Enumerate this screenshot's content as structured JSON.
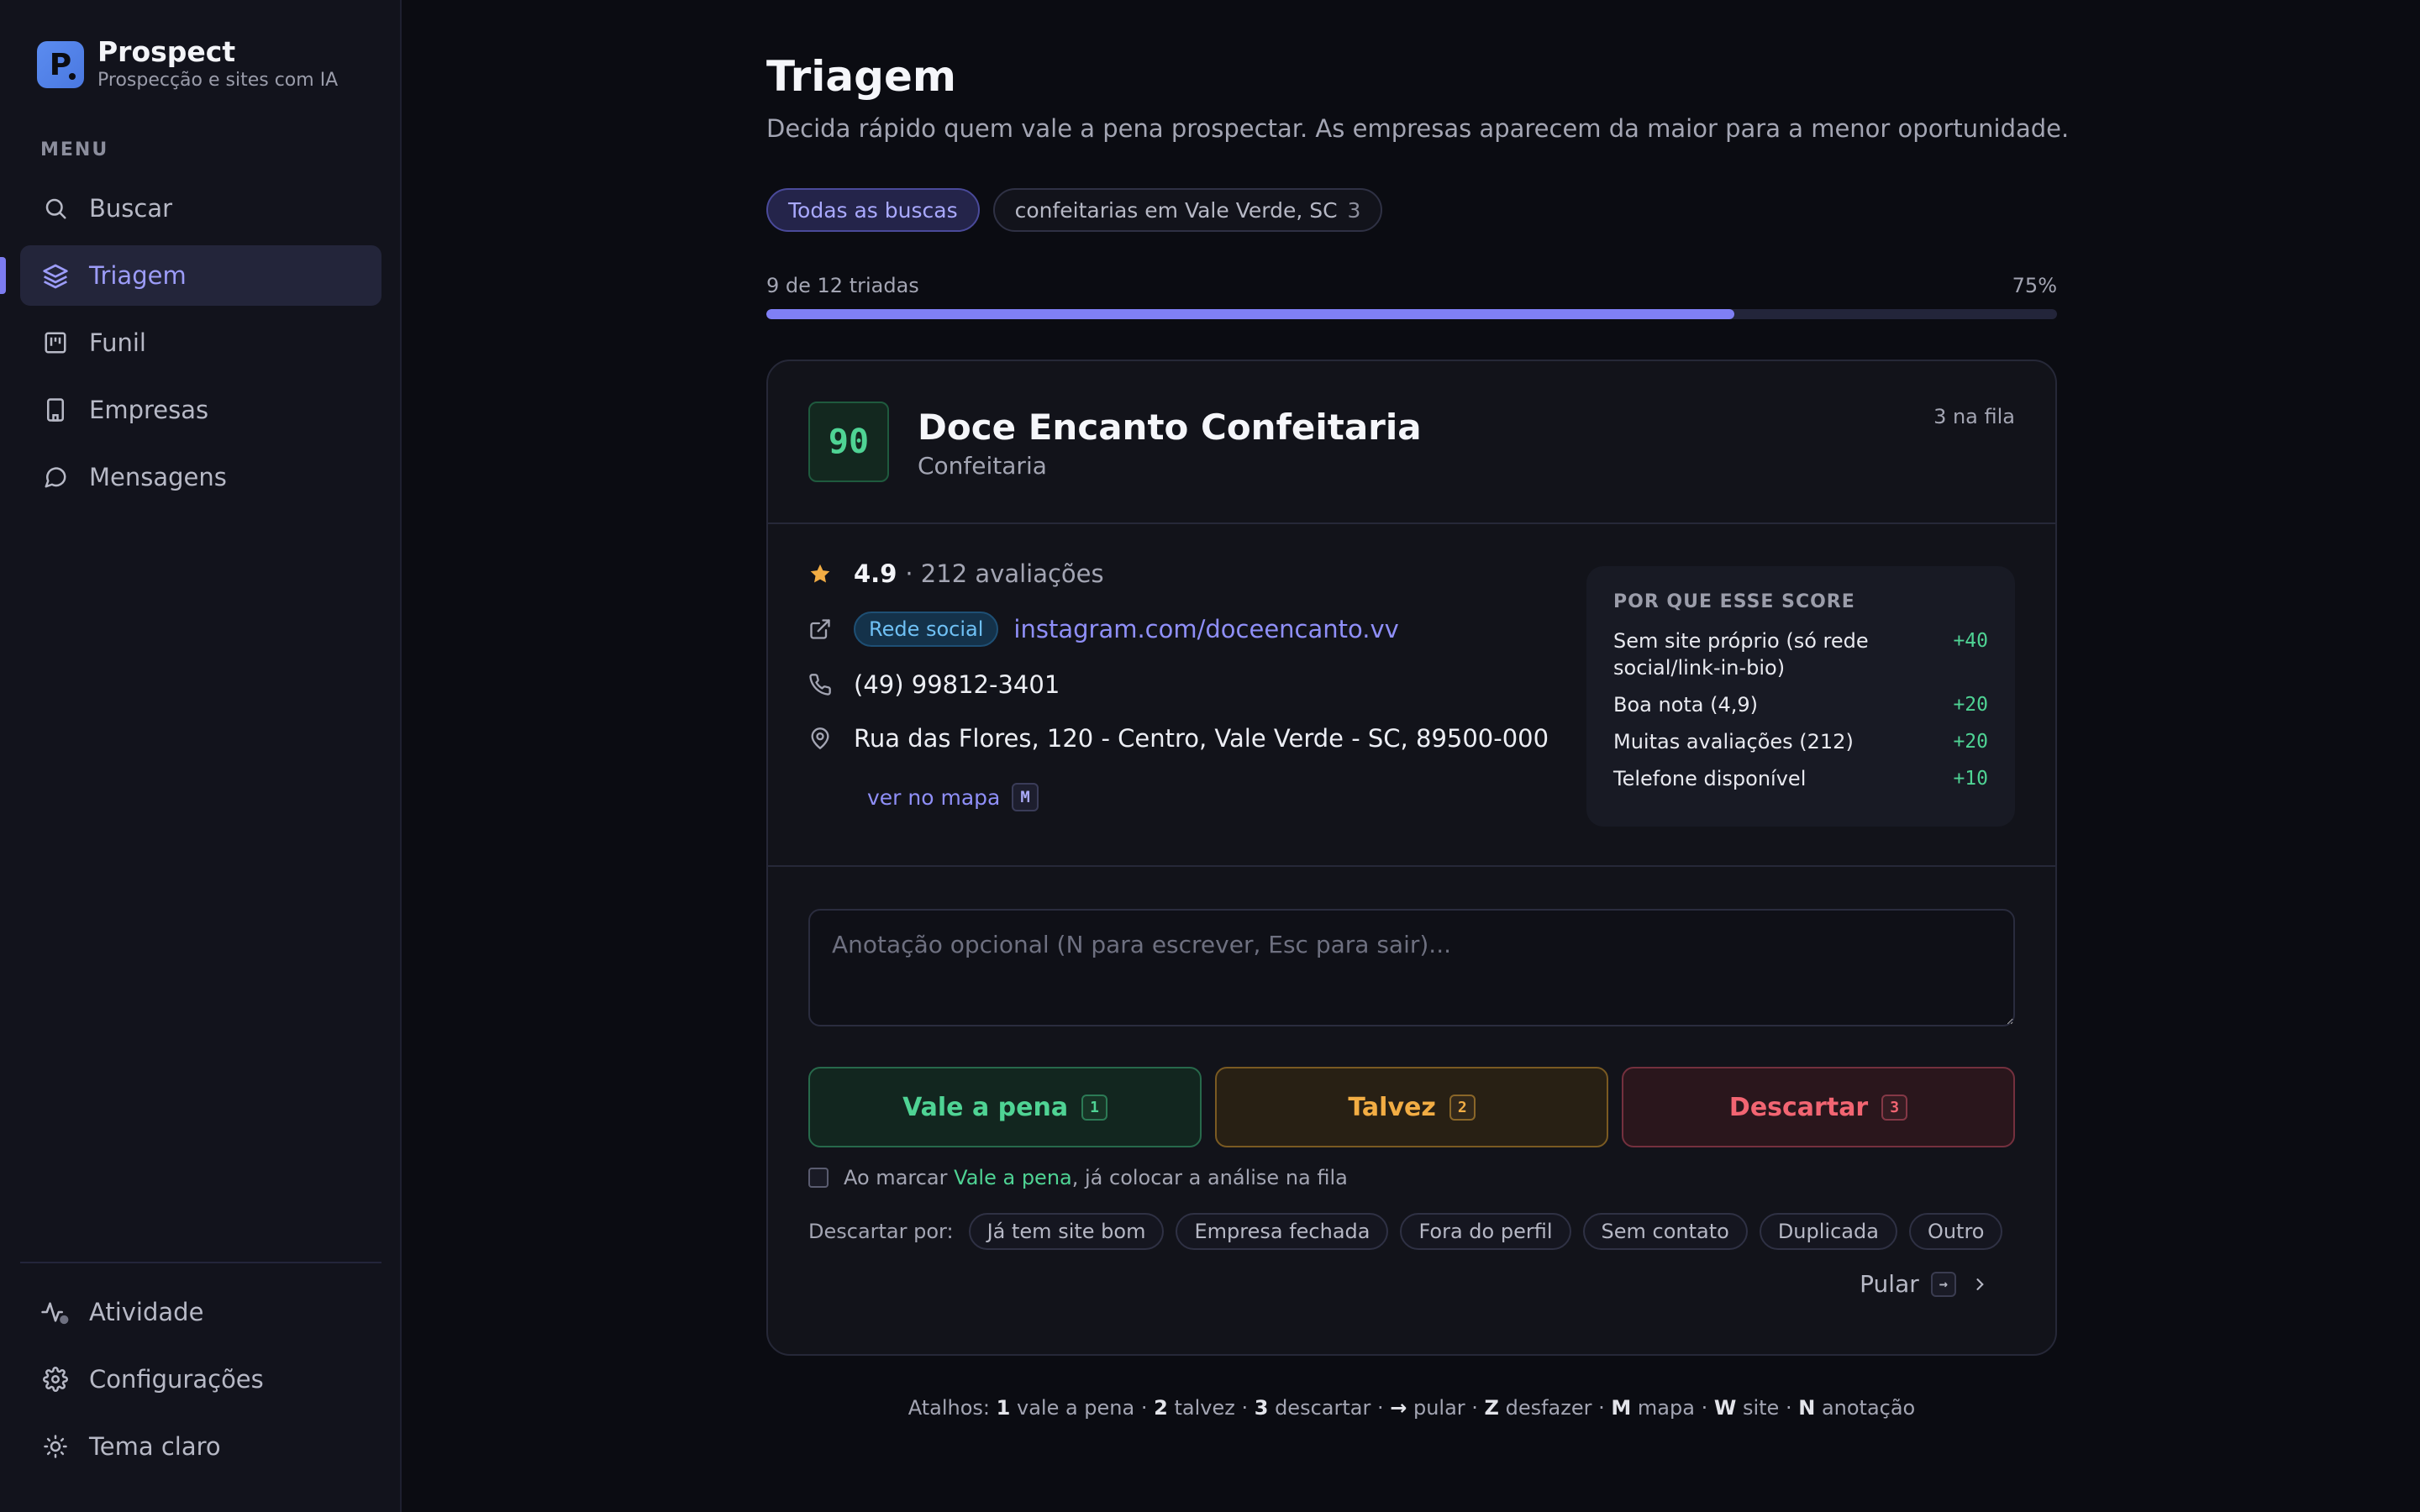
{
  "app": {
    "name": "Prospect",
    "tagline": "Prospecção e sites com IA",
    "logo_letter": "P",
    "accent": "#7f7ff5"
  },
  "sidebar": {
    "menu_label": "MENU",
    "items": [
      {
        "label": "Buscar",
        "icon": "search-icon",
        "active": false
      },
      {
        "label": "Triagem",
        "icon": "layers-icon",
        "active": true
      },
      {
        "label": "Funil",
        "icon": "kanban-icon",
        "active": false
      },
      {
        "label": "Empresas",
        "icon": "building-icon",
        "active": false
      },
      {
        "label": "Mensagens",
        "icon": "message-icon",
        "active": false
      }
    ],
    "bottom_items": [
      {
        "label": "Atividade",
        "icon": "activity-icon"
      },
      {
        "label": "Configurações",
        "icon": "gear-icon"
      },
      {
        "label": "Tema claro",
        "icon": "sun-icon"
      }
    ]
  },
  "page": {
    "title": "Triagem",
    "subtitle": "Decida rápido quem vale a pena prospectar. As empresas aparecem da maior para a menor oportunidade."
  },
  "filters": [
    {
      "label": "Todas as buscas",
      "count": "",
      "active": true
    },
    {
      "label": "confeitarias em Vale Verde, SC",
      "count": "3",
      "active": false
    }
  ],
  "progress": {
    "label": "9 de 12 triadas",
    "percent_label": "75%",
    "fraction": 0.75
  },
  "company": {
    "score": "90",
    "name": "Doce Encanto Confeitaria",
    "category": "Confeitaria",
    "queue": "3 na fila",
    "rating": "4.9",
    "reviews": "· 212 avaliações",
    "social_tag": "Rede social",
    "link": "instagram.com/doceencanto.vv",
    "phone": "(49) 99812-3401",
    "address": "Rua das Flores, 120 - Centro, Vale Verde - SC, 89500-000",
    "map_link": "ver no mapa",
    "map_key": "M"
  },
  "score_box": {
    "title": "POR QUE ESSE SCORE",
    "rows": [
      {
        "label": "Sem site próprio (só rede social/link-in-bio)",
        "value": "+40"
      },
      {
        "label": "Boa nota (4,9)",
        "value": "+20"
      },
      {
        "label": "Muitas avaliações (212)",
        "value": "+20"
      },
      {
        "label": "Telefone disponível",
        "value": "+10"
      }
    ]
  },
  "note": {
    "placeholder": "Anotação opcional (N para escrever, Esc para sair)...",
    "value": ""
  },
  "actions": {
    "yes": {
      "label": "Vale a pena",
      "key": "1",
      "color": "#4fd394"
    },
    "maybe": {
      "label": "Talvez",
      "key": "2",
      "color": "#f2ad44"
    },
    "no": {
      "label": "Descartar",
      "key": "3",
      "color": "#f26572"
    }
  },
  "auto_queue": {
    "prefix": "Ao marcar",
    "highlight": "Vale a pena",
    "suffix": ", já colocar a análise na fila",
    "checked": false
  },
  "discard": {
    "label": "Descartar por:",
    "reasons": [
      "Já tem site bom",
      "Empresa fechada",
      "Fora do perfil",
      "Sem contato",
      "Duplicada",
      "Outro"
    ]
  },
  "skip": {
    "label": "Pular",
    "key": "→"
  },
  "shortcuts": [
    {
      "key": "1",
      "desc": "vale a pena"
    },
    {
      "key": "2",
      "desc": "talvez"
    },
    {
      "key": "3",
      "desc": "descartar"
    },
    {
      "key": "→",
      "desc": "pular"
    },
    {
      "key": "Z",
      "desc": "desfazer"
    },
    {
      "key": "M",
      "desc": "mapa"
    },
    {
      "key": "W",
      "desc": "site"
    },
    {
      "key": "N",
      "desc": "anotação"
    }
  ],
  "shortcuts_prefix": "Atalhos:"
}
